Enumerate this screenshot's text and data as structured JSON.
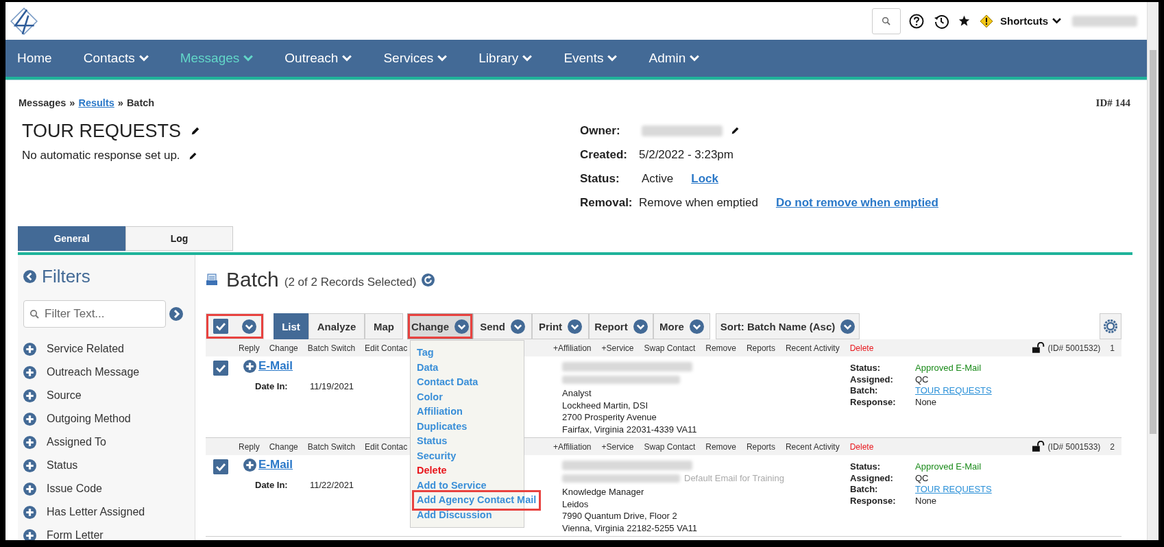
{
  "header": {
    "shortcuts": "Shortcuts"
  },
  "nav": [
    {
      "label": "Home",
      "dropdown": false,
      "selected": false
    },
    {
      "label": "Contacts",
      "dropdown": true,
      "selected": false
    },
    {
      "label": "Messages",
      "dropdown": true,
      "selected": true
    },
    {
      "label": "Outreach",
      "dropdown": true,
      "selected": false
    },
    {
      "label": "Services",
      "dropdown": true,
      "selected": false
    },
    {
      "label": "Library",
      "dropdown": true,
      "selected": false
    },
    {
      "label": "Events",
      "dropdown": true,
      "selected": false
    },
    {
      "label": "Admin",
      "dropdown": true,
      "selected": false
    }
  ],
  "breadcrumb": [
    {
      "label": "Messages",
      "kind": "text"
    },
    {
      "label": "»",
      "kind": "separator"
    },
    {
      "label": "Results",
      "kind": "link"
    },
    {
      "label": "»",
      "kind": "separator"
    },
    {
      "label": "Batch",
      "kind": "text"
    }
  ],
  "record_id": "ID# 144",
  "title": "TOUR REQUESTS",
  "response_note": "No automatic response set up.",
  "details": [
    {
      "label": "Owner:",
      "redacted": true,
      "editable": true
    },
    {
      "label": "Created:",
      "value": "5/2/2022 - 3:23pm",
      "redacted": false,
      "editable": false
    },
    {
      "label": "Status:",
      "value": "Active",
      "link": "Lock",
      "redacted": false,
      "editable": false
    },
    {
      "label": "Removal:",
      "value": "Remove when emptied",
      "link": "Do not remove when emptied",
      "redacted": false,
      "editable": false
    }
  ],
  "tabs": [
    {
      "label": "General",
      "selected": true
    },
    {
      "label": "Log",
      "selected": false
    }
  ],
  "filters": {
    "title": "Filters",
    "placeholder": "Filter Text...",
    "items": [
      "Service Related",
      "Outreach Message",
      "Source",
      "Outgoing Method",
      "Assigned To",
      "Status",
      "Issue Code",
      "Has Letter Assigned",
      "Form Letter"
    ]
  },
  "batch": {
    "title": "Batch",
    "subtitle": "(2 of 2 Records Selected)"
  },
  "toolbar": {
    "select_all": {
      "checked": true,
      "highlighted": true
    },
    "views": [
      {
        "label": "List",
        "selected": true
      },
      {
        "label": "Analyze",
        "selected": false
      },
      {
        "label": "Map",
        "selected": false
      }
    ],
    "actions": [
      {
        "label": "Change",
        "highlighted": true,
        "open": true
      },
      {
        "label": "Send",
        "highlighted": false,
        "open": false
      },
      {
        "label": "Print",
        "highlighted": false,
        "open": false
      },
      {
        "label": "Report",
        "highlighted": false,
        "open": false
      },
      {
        "label": "More",
        "highlighted": false,
        "open": false
      }
    ],
    "sort": "Sort: Batch Name (Asc)"
  },
  "menu": [
    {
      "label": "Tag",
      "kind": "normal",
      "highlighted": false
    },
    {
      "label": "Data",
      "kind": "normal",
      "highlighted": false
    },
    {
      "label": "Contact Data",
      "kind": "normal",
      "highlighted": false
    },
    {
      "label": "Color",
      "kind": "normal",
      "highlighted": false
    },
    {
      "label": "Affiliation",
      "kind": "normal",
      "highlighted": false
    },
    {
      "label": "Duplicates",
      "kind": "normal",
      "highlighted": false
    },
    {
      "label": "Status",
      "kind": "normal",
      "highlighted": false
    },
    {
      "label": "Security",
      "kind": "normal",
      "highlighted": false
    },
    {
      "label": "Delete",
      "kind": "danger",
      "highlighted": false
    },
    {
      "label": "Add to Service",
      "kind": "normal",
      "highlighted": false
    },
    {
      "label": "Add Agency Contact Mail",
      "kind": "normal",
      "highlighted": true
    },
    {
      "label": "Add Discussion",
      "kind": "normal",
      "highlighted": false
    }
  ],
  "records": [
    {
      "checked": true,
      "index": "1",
      "record_id": "(ID# 5001532)",
      "type": "E-Mail",
      "date_label": "Date In:",
      "date": "11/19/2021",
      "actions": [
        {
          "label": "Reply",
          "kind": "normal"
        },
        {
          "label": "Change",
          "kind": "normal"
        },
        {
          "label": "Batch Switch",
          "kind": "normal"
        },
        {
          "label": "Edit Contac",
          "kind": "normal"
        }
      ],
      "more_actions": [
        {
          "label": "+Affiliation",
          "kind": "normal"
        },
        {
          "label": "+Service",
          "kind": "normal"
        },
        {
          "label": "Swap Contact",
          "kind": "normal"
        },
        {
          "label": "Remove",
          "kind": "normal"
        },
        {
          "label": "Reports",
          "kind": "normal"
        },
        {
          "label": "Recent Activity",
          "kind": "normal"
        },
        {
          "label": "Delete",
          "kind": "danger"
        }
      ],
      "contact_lines": [
        "Analyst",
        "Lockheed Martin, DSI",
        "2700 Prosperity Avenue",
        "Fairfax, Virginia 22031-4339 VA11"
      ],
      "fields": [
        {
          "label": "Status:",
          "value": "Approved E-Mail",
          "kind": "status"
        },
        {
          "label": "Assigned:",
          "value": "QC",
          "kind": "text"
        },
        {
          "label": "Batch:",
          "value": "TOUR REQUESTS",
          "kind": "link"
        },
        {
          "label": "Response:",
          "value": "None",
          "kind": "text"
        }
      ]
    },
    {
      "checked": true,
      "index": "2",
      "record_id": "(ID# 5001533)",
      "type": "E-Mail",
      "date_label": "Date In:",
      "date": "11/22/2021",
      "actions": [
        {
          "label": "Reply",
          "kind": "normal"
        },
        {
          "label": "Change",
          "kind": "normal"
        },
        {
          "label": "Batch Switch",
          "kind": "normal"
        },
        {
          "label": "Edit Contac",
          "kind": "normal"
        }
      ],
      "more_actions": [
        {
          "label": "+Affiliation",
          "kind": "normal"
        },
        {
          "label": "+Service",
          "kind": "normal"
        },
        {
          "label": "Swap Contact",
          "kind": "normal"
        },
        {
          "label": "Remove",
          "kind": "normal"
        },
        {
          "label": "Reports",
          "kind": "normal"
        },
        {
          "label": "Recent Activity",
          "kind": "normal"
        },
        {
          "label": "Delete",
          "kind": "danger"
        }
      ],
      "email_note": "Default Email for Training",
      "contact_lines": [
        "Knowledge Manager",
        "Leidos",
        "7990 Quantum Drive, Floor 2",
        "Vienna, Virginia 22182-5255 VA11"
      ],
      "fields": [
        {
          "label": "Status:",
          "value": "Approved E-Mail",
          "kind": "status"
        },
        {
          "label": "Assigned:",
          "value": "QC",
          "kind": "text"
        },
        {
          "label": "Batch:",
          "value": "TOUR REQUESTS",
          "kind": "link"
        },
        {
          "label": "Response:",
          "value": "None",
          "kind": "text"
        }
      ]
    }
  ]
}
